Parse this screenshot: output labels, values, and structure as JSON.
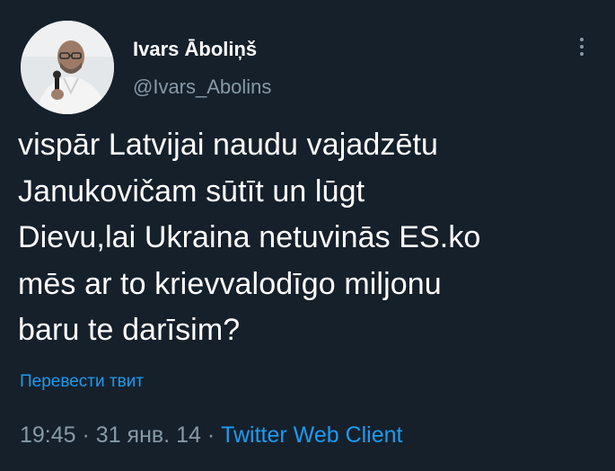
{
  "author": {
    "display_name": "Ivars Āboliņš",
    "handle": "@Ivars_Abolins"
  },
  "tweet": {
    "lines": [
      "vispār Latvijai naudu vajadzētu",
      "Janukovičam sūtīt un lūgt",
      "Dievu,lai Ukraina netuvinās ES.ko",
      "mēs ar to krievvalodīgo miljonu",
      "baru te darīsim?"
    ]
  },
  "translate_label": "Перевести твит",
  "meta": {
    "time": "19:45",
    "separator": "·",
    "date": "31 янв. 14",
    "source": "Twitter Web Client"
  },
  "icons": {
    "more": "more-vertical-icon",
    "avatar": "user-avatar"
  },
  "colors": {
    "background": "#15202b",
    "text": "#ffffff",
    "secondary": "#8899a6",
    "accent": "#1d9bf0"
  }
}
